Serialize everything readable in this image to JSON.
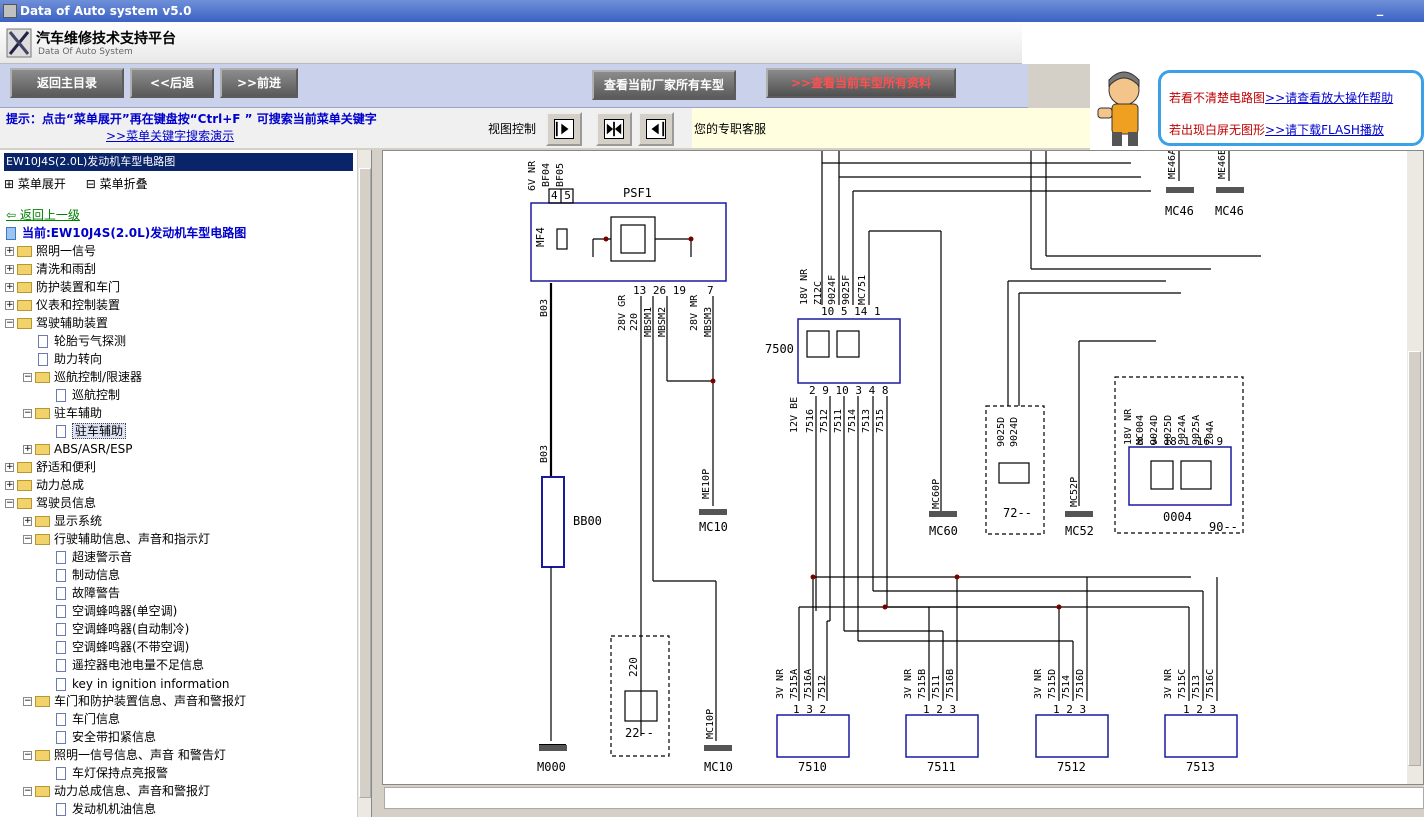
{
  "window": {
    "title": "Data of Auto system v5.0"
  },
  "header": {
    "brand": "汽车维修技术支持平台",
    "brand_sub": "Data Of Auto System"
  },
  "toolbar": {
    "back_main": "返回主目录",
    "prev": "<<后退",
    "next": ">>前进",
    "view_maker": "查看当前厂家所有车型",
    "view_all": ">>查看当前车型所有资料"
  },
  "hint": {
    "line1": "提示：点击“菜单展开”再在键盘按“Ctrl+F ” 可搜索当前菜单关键字",
    "line2": ">>菜单关键字搜索演示"
  },
  "view_control": {
    "label": "视图控制"
  },
  "service": {
    "text": "您的专职客服"
  },
  "help": {
    "line1_text": "若看不清楚电路图",
    "line1_link": ">>请查看放大操作帮助",
    "line2_text": "若出现白屏无图形",
    "line2_link": ">>请下载FLASH播放"
  },
  "sidebar": {
    "title": "EW10J4S(2.0L)发动机车型电路图",
    "expand": "菜单展开",
    "collapse": "菜单折叠",
    "back": "返回上一级",
    "current": "当前:EW10J4S(2.0L)发动机车型电路图",
    "items": [
      {
        "label": "照明一信号"
      },
      {
        "label": "清洗和雨刮"
      },
      {
        "label": "防护装置和车门"
      },
      {
        "label": "仪表和控制装置"
      },
      {
        "label": "驾驶辅助装置"
      },
      {
        "label": "轮胎亏气探测"
      },
      {
        "label": "助力转向"
      },
      {
        "label": "巡航控制/限速器"
      },
      {
        "label": "巡航控制"
      },
      {
        "label": "驻车辅助"
      },
      {
        "label": "驻车辅助"
      },
      {
        "label": "ABS/ASR/ESP"
      },
      {
        "label": "舒适和便利"
      },
      {
        "label": "动力总成"
      },
      {
        "label": "驾驶员信息"
      },
      {
        "label": "显示系统"
      },
      {
        "label": "行驶辅助信息、声音和指示灯"
      },
      {
        "label": "超速警示音"
      },
      {
        "label": "制动信息"
      },
      {
        "label": "故障警告"
      },
      {
        "label": "空调蜂鸣器(单空调)"
      },
      {
        "label": "空调蜂鸣器(自动制冷)"
      },
      {
        "label": "空调蜂鸣器(不带空调)"
      },
      {
        "label": "遥控器电池电量不足信息"
      },
      {
        "label": "key in ignition information"
      },
      {
        "label": "车门和防护装置信息、声音和警报灯"
      },
      {
        "label": "车门信息"
      },
      {
        "label": "安全带扣紧信息"
      },
      {
        "label": "照明一信号信息、声音 和警告灯"
      },
      {
        "label": "车灯保持点亮报警"
      },
      {
        "label": "动力总成信息、声音和警报灯"
      },
      {
        "label": "发动机机油信息"
      }
    ]
  },
  "diagram": {
    "psf1": "PSF1",
    "mf4": "MF4",
    "bb00": "BB00",
    "b03a": "B03",
    "b03b": "B03",
    "m000": "M000",
    "mc10a": "MC10",
    "mc10b": "MC10",
    "me10p": "ME10P",
    "mc10p": "MC10P",
    "box22": "22--",
    "num220a": "220",
    "num220b": "220",
    "c7500": "7500",
    "mc60p": "MC60P",
    "mc60": "MC60",
    "box72": "72--",
    "mc52p": "MC52P",
    "mc52": "MC52",
    "c0004": "0004",
    "box90": "90--",
    "me46a": "ME46A",
    "mc46a": "MC46",
    "me46b": "ME46B",
    "mc46b": "MC46",
    "s7510": "7510",
    "s7511": "7511",
    "s7512": "7512",
    "s7513": "7513",
    "psf_pins_top": "4 5",
    "psf_pins_bottom": "13 26 19",
    "psf_pin7": "7",
    "wire_top": "6V NR",
    "wire_bf04": "BF04",
    "wire_bf05": "BF05",
    "w28gr": "28V GR",
    "wmbsm1": "MBSM1",
    "wmbsm2": "MBSM2",
    "w28mr": "28V MR",
    "wmbsm3": "MBSM3",
    "w18nr": "18V NR",
    "wz12c": "Z12C",
    "w9024f": "9024F",
    "w9025f": "9025F",
    "wmc751": "MC751",
    "pins7500_top": "10 5 14 1",
    "pins7500_bottom": "2 9 10 3 4 8",
    "w12vbe": "12V BE",
    "w7516": "7516",
    "w7512": "7512",
    "w7511": "7511",
    "w7514": "7514",
    "w7513": "7513",
    "w7515": "7515",
    "w9025d": "9025D",
    "w9024d": "9024D",
    "w18vnr": "18V NR",
    "wmc004": "MC004",
    "w9024d2": "9024D",
    "w9025d2": "9025D",
    "w9024a": "9024A",
    "w9025a": "9025A",
    "wz04a": "Z04A",
    "pins0004": "8 3 18 1 16 9",
    "s_pins": "1 3 2",
    "s_pins2": "1 2 3",
    "s_wire3v": "3V NR",
    "s7515a": "7515A",
    "s7516a": "7516A",
    "s7515b": "7515B",
    "s7516b": "7516B",
    "s7515d": "7515D",
    "s7514": "7514",
    "s7516d": "7516D",
    "s7515c": "7515C",
    "s7513w": "7513",
    "s7516c": "7516C"
  }
}
